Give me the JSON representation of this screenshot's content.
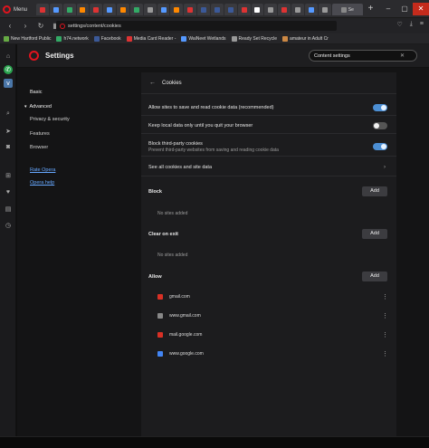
{
  "titlebar": {
    "menu_label": "Menu",
    "tabs": [
      {
        "color": "#d33"
      },
      {
        "color": "#59f"
      },
      {
        "color": "#3a6"
      },
      {
        "color": "#f80"
      },
      {
        "color": "#d33"
      },
      {
        "color": "#59f"
      },
      {
        "color": "#f80"
      },
      {
        "color": "#3a6"
      },
      {
        "color": "#999"
      },
      {
        "color": "#59f"
      },
      {
        "color": "#f80"
      },
      {
        "color": "#d33"
      },
      {
        "color": "#3b5998"
      },
      {
        "color": "#3b5998"
      },
      {
        "color": "#3b5998"
      },
      {
        "color": "#d33"
      },
      {
        "color": "#fff"
      },
      {
        "color": "#999"
      },
      {
        "color": "#d33"
      },
      {
        "color": "#999"
      },
      {
        "color": "#59f"
      },
      {
        "color": "#999"
      }
    ],
    "active_tab_label": "Se",
    "new_tab_label": "+",
    "min_label": "–",
    "max_label": "▢",
    "close_label": "✕"
  },
  "addressbar": {
    "url": "settings/content/cookies"
  },
  "bookmarks": [
    {
      "label": "New Hartford Public",
      "color": "#6a4"
    },
    {
      "label": "h74.network",
      "color": "#3a6"
    },
    {
      "label": "Facebook",
      "color": "#3b5998"
    },
    {
      "label": "Media Card Reader -",
      "color": "#d33"
    },
    {
      "label": "WaiNeet Wetlands",
      "color": "#59f"
    },
    {
      "label": "Ready Set Recycle",
      "color": "#999"
    },
    {
      "label": "amateur in Adult Cr",
      "color": "#c84"
    }
  ],
  "settings": {
    "title": "Settings",
    "search_value": "Content settings",
    "nav": {
      "basic": "Basic",
      "advanced": "Advanced",
      "privacy": "Privacy & security",
      "features": "Features",
      "browser": "Browser",
      "rate": "Rate Opera",
      "help": "Opera help"
    }
  },
  "cookies": {
    "title": "Cookies",
    "allow_sites": "Allow sites to save and read cookie data (recommended)",
    "keep_local": "Keep local data only until you quit your browser",
    "block_third": "Block third-party cookies",
    "block_third_sub": "Prevent third-party websites from saving and reading cookie data",
    "see_all": "See all cookies and site data",
    "block_label": "Block",
    "clear_label": "Clear on exit",
    "allow_label": "Allow",
    "add_label": "Add",
    "no_sites": "No sites added",
    "allowed_sites": [
      {
        "name": "gmail.com",
        "color": "#d93025"
      },
      {
        "name": "www.gmail.com",
        "color": "#888888"
      },
      {
        "name": "mail.google.com",
        "color": "#d93025"
      },
      {
        "name": "www.google.com",
        "color": "#4285f4"
      }
    ],
    "toggles": {
      "allow_sites": true,
      "keep_local": false,
      "block_third": true
    }
  }
}
